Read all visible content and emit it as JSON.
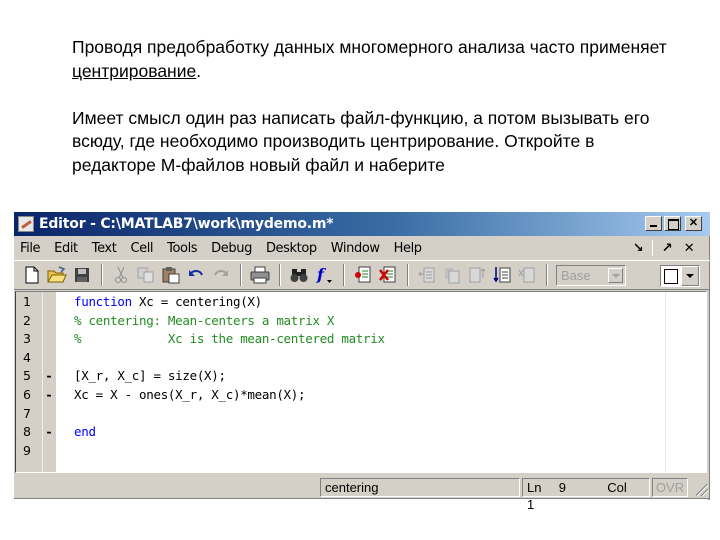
{
  "slide": {
    "paragraph1_before": "Проводя предобработку данных многомерного анализа часто применяет ",
    "paragraph1_link": "центрирование",
    "paragraph1_after": ".",
    "paragraph2": " Имеет смысл один раз написать файл-функцию, а потом вызывать его всюду, где необходимо производить центрирование. Откройте в редакторе М-файлов новый файл и наберите"
  },
  "window": {
    "title": "Editor - C:\\MATLAB7\\work\\mydemo.m*",
    "controls": {
      "minimize": "_",
      "maximize": "□",
      "close": "✕"
    }
  },
  "menubar": {
    "items": [
      "File",
      "Edit",
      "Text",
      "Cell",
      "Tools",
      "Debug",
      "Desktop",
      "Window",
      "Help"
    ],
    "right": {
      "undock": "↘",
      "dock": "↗",
      "close": "✕"
    }
  },
  "toolbar": {
    "icons": [
      "new-file",
      "open-file",
      "save",
      "cut",
      "copy",
      "paste",
      "undo",
      "redo",
      "print",
      "find",
      "function",
      "set-breakpoint",
      "clear-breakpoints",
      "step",
      "step-in",
      "step-out",
      "continue",
      "exit-debug"
    ],
    "stack_combo": "Base",
    "colors": {
      "function_blue": "#0000cc",
      "breakpoint_red": "#cc0000"
    }
  },
  "editor": {
    "lines": [
      {
        "num": "1",
        "marker": "",
        "segments": [
          {
            "t": "function",
            "c": "kw"
          },
          {
            "t": " Xc = centering(X)",
            "c": ""
          }
        ]
      },
      {
        "num": "2",
        "marker": "",
        "segments": [
          {
            "t": "% centering: Mean-centers a matrix X",
            "c": "cm"
          }
        ]
      },
      {
        "num": "3",
        "marker": "",
        "segments": [
          {
            "t": "%            Xc is the mean-centered matrix",
            "c": "cm"
          }
        ]
      },
      {
        "num": "4",
        "marker": "",
        "segments": []
      },
      {
        "num": "5",
        "marker": "-",
        "segments": [
          {
            "t": "[X_r, X_c] = size(X);",
            "c": ""
          }
        ]
      },
      {
        "num": "6",
        "marker": "-",
        "segments": [
          {
            "t": "Xc = X - ones(X_r, X_c)*mean(X);",
            "c": ""
          }
        ]
      },
      {
        "num": "7",
        "marker": "",
        "segments": []
      },
      {
        "num": "8",
        "marker": "-",
        "segments": [
          {
            "t": "end",
            "c": "kw"
          }
        ]
      },
      {
        "num": "9",
        "marker": "",
        "segments": []
      }
    ],
    "colors": {
      "keyword": "#0000ff",
      "comment": "#228b22"
    }
  },
  "statusbar": {
    "function": "centering",
    "ln_label": "Ln",
    "ln_value": "9",
    "col_label": "Col",
    "col_value": "1",
    "ovr": "OVR"
  }
}
